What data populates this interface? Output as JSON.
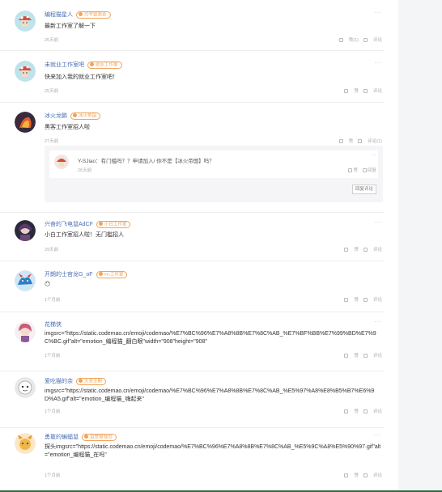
{
  "comments": [
    {
      "name": "编程猫星人",
      "badge": "元宇宙商会",
      "text": "最新工作室了解一下",
      "time": "26天前",
      "like": "赞(1)",
      "reply": "评论"
    },
    {
      "name": "未就业工作室吧",
      "badge": "就业工作室",
      "text": "快来加入我的就业工作室吧！",
      "time": "25天前",
      "like": "赞",
      "reply": "评论"
    },
    {
      "name": "冰火龙鹏",
      "badge": "冰火帝国",
      "text": "黑客工作室招人啦",
      "time": "27天前",
      "like": "赞",
      "reply": "评论(1)",
      "sub": {
        "text": "Y-SJiao：有门槛吗？？申请加入/ 你不是【冰火帝国】吗？",
        "time": "26天前",
        "like": "赞",
        "reply": "回复",
        "button": "回复评论"
      }
    },
    {
      "name": "兴奋的飞电鼠AdCF",
      "badge": "小白工作室",
      "text": "小白工作室招人啦！无门槛招人",
      "time": "29天前",
      "like": "赞",
      "reply": "评论"
    },
    {
      "name": "开朗的士官龙G_oF",
      "badge": "mc工作室",
      "text": "😶",
      "time": "1个月前",
      "like": "赞",
      "reply": "评论"
    },
    {
      "name": "花梯侠",
      "badge": "",
      "text": "imgsrc=\"https://static.codemao.cn/emoji/codemao/%E7%BC%96%E7%A8%8B%E7%8C%AB_%E7%BF%BB%E7%99%BD%E7%9C%BC.gif\"alt=\"emotion_编程猫_翻白眼\"width=\"908\"height=\"908\"",
      "time": "1个月前",
      "like": "赞",
      "reply": "评论"
    },
    {
      "name": "爱吃猫的余",
      "badge": "大余王朝",
      "text": "imgsrc=\"https://static.codemao.cn/emoji/codemao/%E7%BC%96%E7%A8%8B%E7%8C%AB_%E5%97%A8%E8%B5%B7%E6%9D%A5.gif\"alt=\"emotion_编程猫_嗨起来\"",
      "time": "1个月前",
      "like": "赞",
      "reply": "评论"
    },
    {
      "name": "勇敢的蝙蝠鼠",
      "badge": "运营管理员",
      "text": "探头imgsrc=\"https://static.codemao.cn/emoji/codemao/%E7%BC%96%E7%A8%8B%E7%8C%AB_%E5%9C%A8%E5%90%97.gif\"alt=\"emotion_编程猫_在吗\"",
      "time": "1个月前",
      "like": "赞",
      "reply": "评论"
    }
  ],
  "more_label": "···",
  "colors": {
    "accent": "#4a6fb5",
    "badge": "#f0a35a"
  }
}
